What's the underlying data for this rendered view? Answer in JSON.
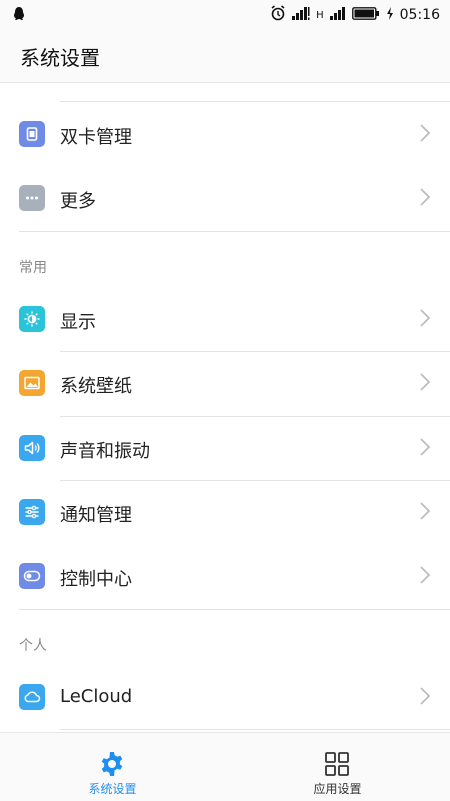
{
  "status_bar": {
    "network_h": "H",
    "time": "05:16"
  },
  "title": "系统设置",
  "rows_top": [
    {
      "label": "双卡管理",
      "icon": "sim-card-icon",
      "color": "#6f8be6"
    },
    {
      "label": "更多",
      "icon": "more-icon",
      "color": "#a8b0bc"
    }
  ],
  "section_common": "常用",
  "rows_common": [
    {
      "label": "显示",
      "icon": "brightness-icon",
      "color": "#2bc3d8"
    },
    {
      "label": "系统壁纸",
      "icon": "wallpaper-icon",
      "color": "#f3a631"
    },
    {
      "label": "声音和振动",
      "icon": "sound-icon",
      "color": "#3aa7ee"
    },
    {
      "label": "通知管理",
      "icon": "notification-sliders-icon",
      "color": "#3aa7ee"
    },
    {
      "label": "控制中心",
      "icon": "control-center-toggle-icon",
      "color": "#6f8be6"
    }
  ],
  "section_personal": "个人",
  "rows_personal": [
    {
      "label": "LeCloud",
      "icon": "cloud-icon",
      "color": "#3aa7ee"
    }
  ],
  "bottom_nav": [
    {
      "label": "系统设置",
      "icon": "gear-icon",
      "active": true,
      "color": "#1e8ff0"
    },
    {
      "label": "应用设置",
      "icon": "grid-icon",
      "active": false,
      "color": "#333333"
    }
  ]
}
